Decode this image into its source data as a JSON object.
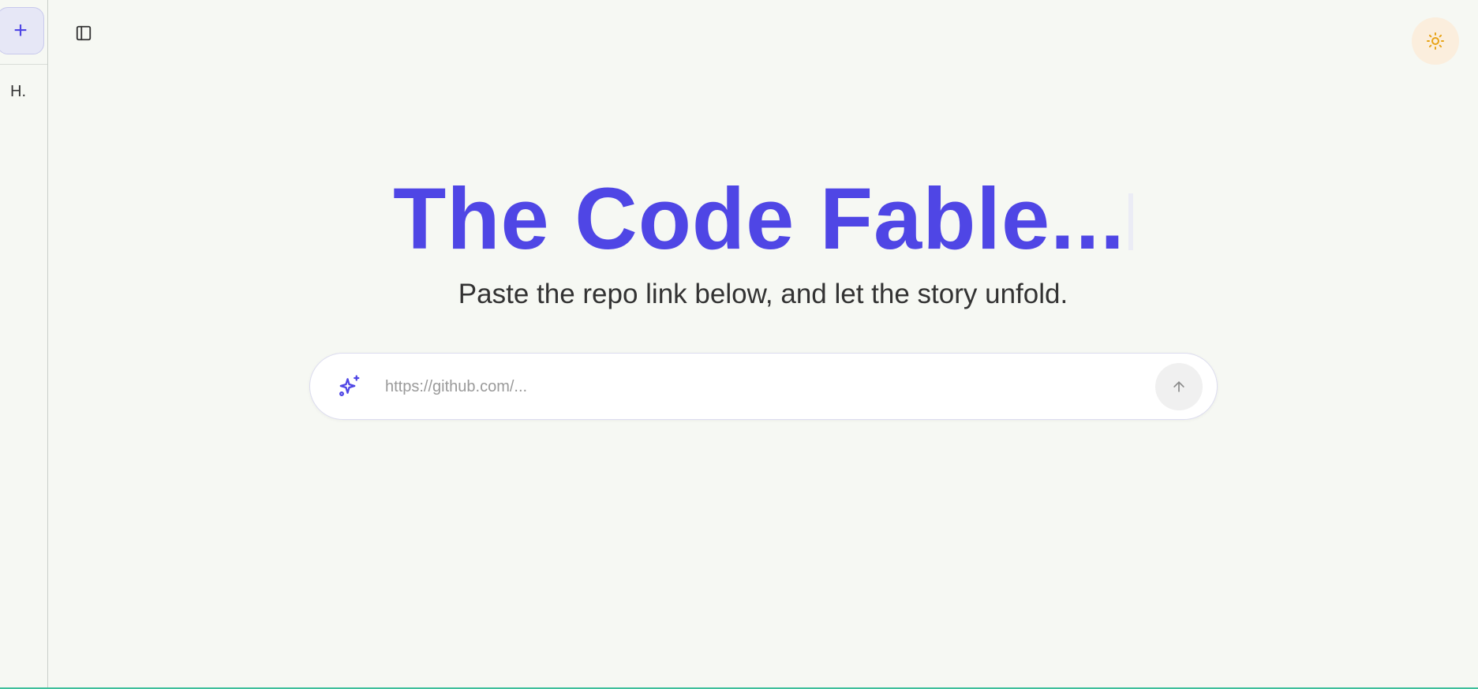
{
  "sidebar": {
    "new_chat_symbol": "+",
    "history": [
      {
        "label": "H."
      }
    ]
  },
  "header": {
    "toggle_icon": "panel-left-icon",
    "theme_icon": "sun-icon"
  },
  "hero": {
    "title": "The Code Fable...",
    "subtitle": "Paste the repo link below, and let the story unfold."
  },
  "search": {
    "placeholder": "https://github.com/...",
    "value": "",
    "leading_icon": "sparkles-icon",
    "submit_icon": "arrow-up-icon"
  },
  "colors": {
    "accent": "#4f46e5",
    "background": "#f6f8f3",
    "sun": "#e8a317",
    "bottom_line": "#3fbf9b"
  }
}
